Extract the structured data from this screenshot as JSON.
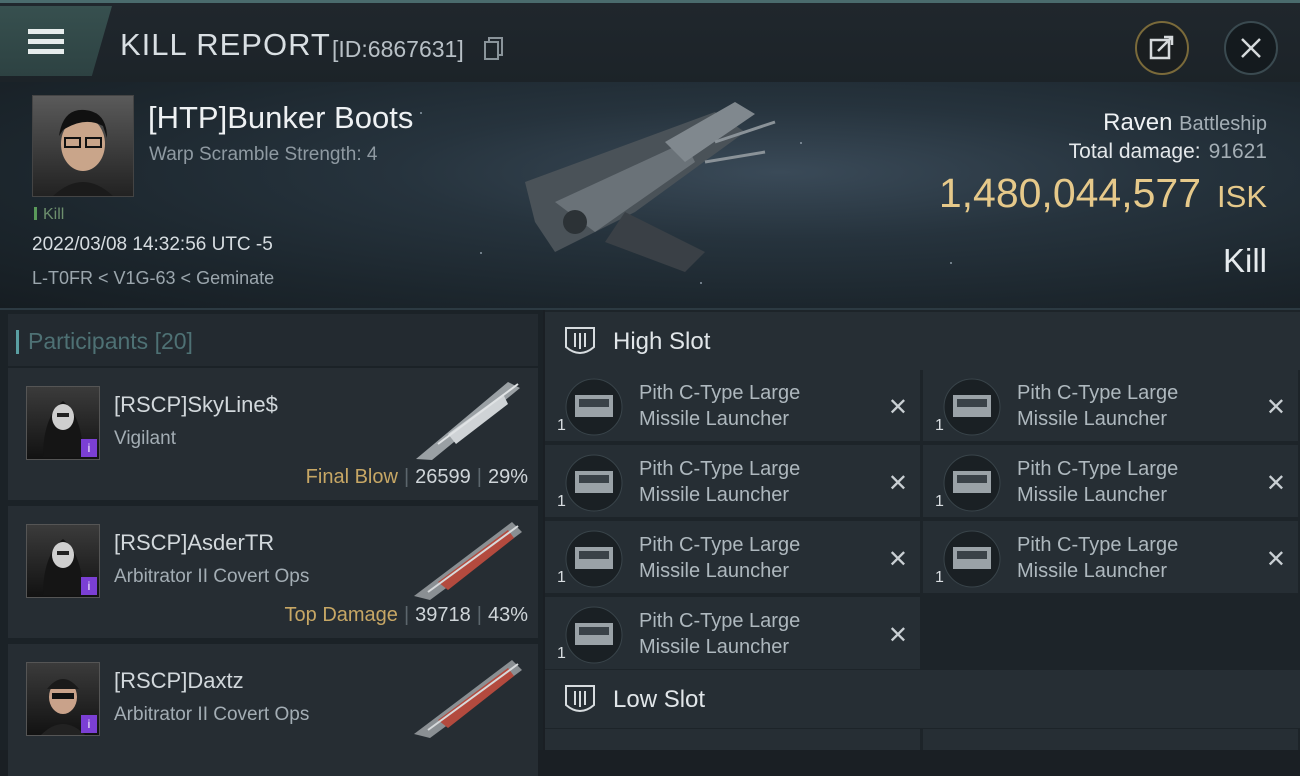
{
  "header": {
    "title": "KILL REPORT",
    "report_id": "[ID:6867631]"
  },
  "victim": {
    "name": "[HTP]Bunker Boots",
    "subtitle": "Warp Scramble Strength: 4",
    "kill_tag": "Kill",
    "datetime": "2022/03/08 14:32:56 UTC -5",
    "location": "L-T0FR < V1G-63 < Geminate",
    "ship_name": "Raven",
    "ship_class": "Battleship",
    "total_damage_label": "Total damage:",
    "total_damage": "91621",
    "isk_value": "1,480,044,577",
    "isk_unit": "ISK",
    "result": "Kill"
  },
  "participants": {
    "label": "Participants",
    "count": "[20]",
    "items": [
      {
        "name": "[RSCP]SkyLine$",
        "ship": "Vigilant",
        "tag": "Final Blow",
        "damage": "26599",
        "percent": "29%",
        "badge": "i"
      },
      {
        "name": "[RSCP]AsderTR",
        "ship": "Arbitrator II Covert Ops",
        "tag": "Top Damage",
        "damage": "39718",
        "percent": "43%",
        "badge": "i"
      },
      {
        "name": "[RSCP]Daxtz",
        "ship": "Arbitrator II Covert Ops",
        "tag": "",
        "damage": "",
        "percent": "",
        "badge": "i"
      }
    ]
  },
  "slots": {
    "high": {
      "title": "High Slot",
      "items": [
        {
          "line1": "Pith C-Type Large",
          "line2": "Missile Launcher",
          "qty": "1"
        },
        {
          "line1": "Pith C-Type Large",
          "line2": "Missile Launcher",
          "qty": "1"
        },
        {
          "line1": "Pith C-Type Large",
          "line2": "Missile Launcher",
          "qty": "1"
        },
        {
          "line1": "Pith C-Type Large",
          "line2": "Missile Launcher",
          "qty": "1"
        },
        {
          "line1": "Pith C-Type Large",
          "line2": "Missile Launcher",
          "qty": "1"
        },
        {
          "line1": "Pith C-Type Large",
          "line2": "Missile Launcher",
          "qty": "1"
        },
        {
          "line1": "Pith C-Type Large",
          "line2": "Missile Launcher",
          "qty": "1"
        }
      ]
    },
    "low": {
      "title": "Low Slot"
    }
  },
  "icons": {
    "menu": "hamburger-menu-icon",
    "copy": "copy-icon",
    "share": "share-icon",
    "close": "close-icon",
    "slot": "slot-icon",
    "destroyed": "x-icon"
  },
  "colors": {
    "isk": "#e6c98a",
    "tag": "#c7a765",
    "accent": "#5a9fa2"
  }
}
